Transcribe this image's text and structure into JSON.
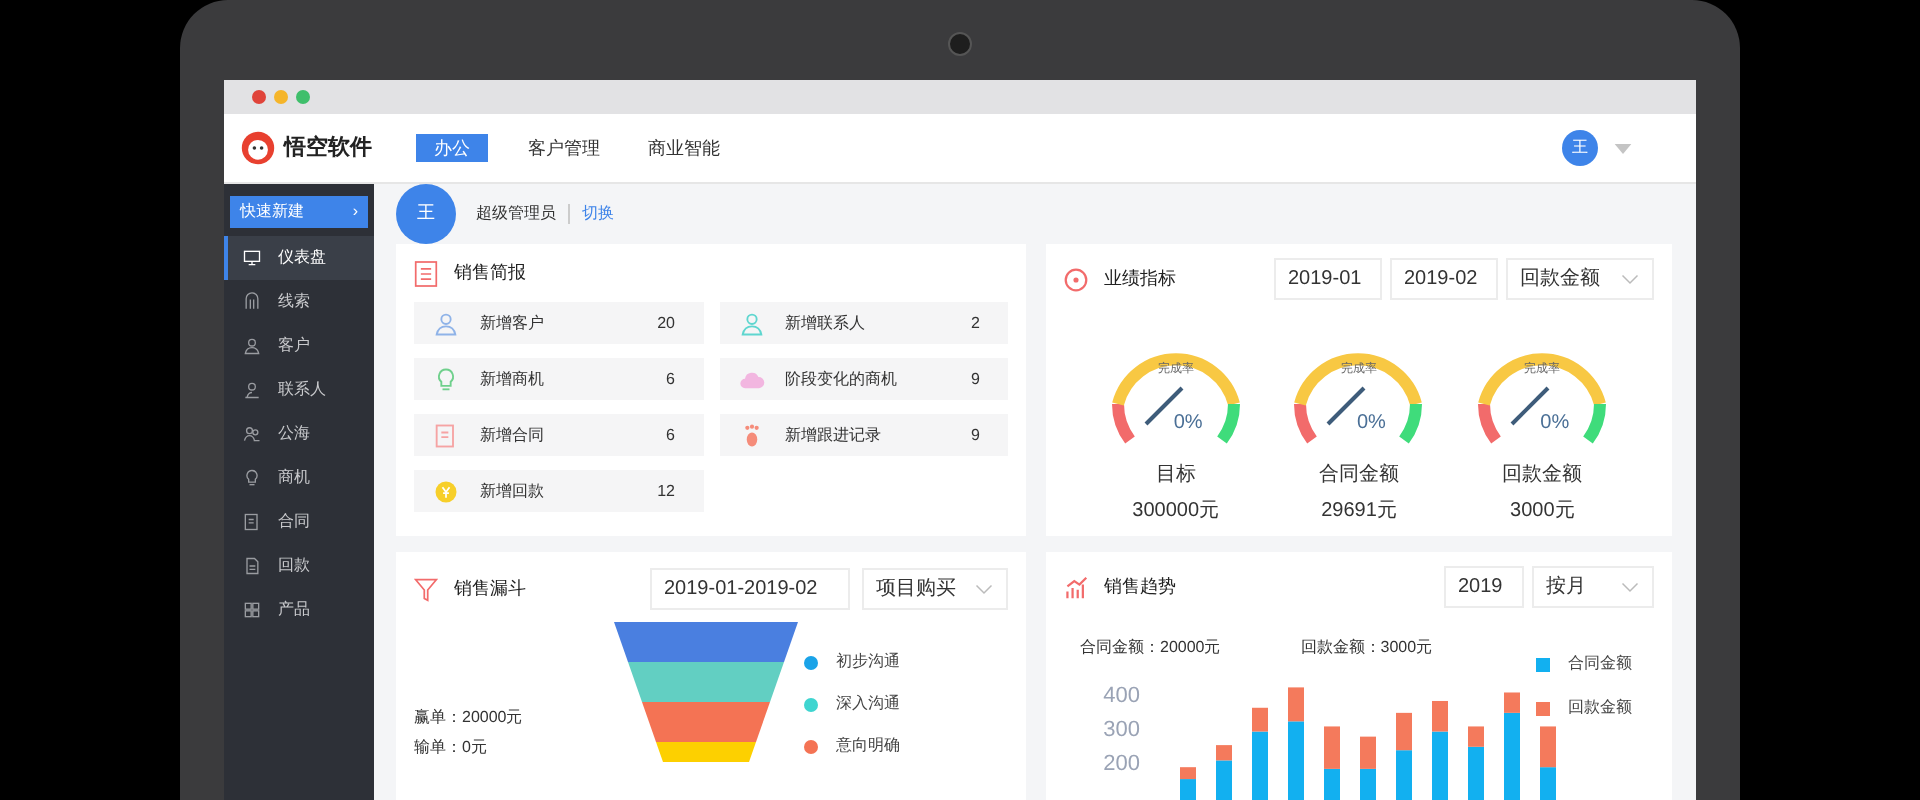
{
  "app": {
    "logo_text": "悟空软件"
  },
  "nav_tabs": [
    {
      "label": "办公",
      "selected": true
    },
    {
      "label": "客户管理",
      "selected": false
    },
    {
      "label": "商业智能",
      "selected": false
    }
  ],
  "header_avatar": "王",
  "sidebar": {
    "quick_create": "快速新建",
    "quick_create_arrow": "›",
    "items": [
      {
        "label": "仪表盘",
        "selected": true
      },
      {
        "label": "线索",
        "selected": false
      },
      {
        "label": "客户",
        "selected": false
      },
      {
        "label": "联系人",
        "selected": false
      },
      {
        "label": "公海",
        "selected": false
      },
      {
        "label": "商机",
        "selected": false
      },
      {
        "label": "合同",
        "selected": false
      },
      {
        "label": "回款",
        "selected": false
      },
      {
        "label": "产品",
        "selected": false
      }
    ]
  },
  "profile": {
    "avatar": "王",
    "role": "超级管理员",
    "switch_link": "切换"
  },
  "sales_brief": {
    "title": "销售简报",
    "items": [
      {
        "label": "新增客户",
        "value": "20",
        "color": "#8fb3e8"
      },
      {
        "label": "新增联系人",
        "value": "2",
        "color": "#5fd6cf"
      },
      {
        "label": "新增商机",
        "value": "6",
        "color": "#6fd08c"
      },
      {
        "label": "阶段变化的商机",
        "value": "9",
        "color": "#f2b6e0"
      },
      {
        "label": "新增合同",
        "value": "6",
        "color": "#f6a3a3"
      },
      {
        "label": "新增跟进记录",
        "value": "9",
        "color": "#f58c7a"
      },
      {
        "label": "新增回款",
        "value": "12",
        "color": "#f7cf2a"
      }
    ]
  },
  "performance": {
    "title": "业绩指标",
    "start": "2019-01",
    "end": "2019-02",
    "select": "回款金额",
    "gauges": [
      {
        "caption": "完成率",
        "percent": "0%",
        "label": "目标",
        "amount": "300000元"
      },
      {
        "caption": "完成率",
        "percent": "0%",
        "label": "合同金额",
        "amount": "29691元"
      },
      {
        "caption": "完成率",
        "percent": "0%",
        "label": "回款金额",
        "amount": "3000元"
      }
    ]
  },
  "funnel": {
    "title": "销售漏斗",
    "range": "2019-01-2019-02",
    "select": "项目购买",
    "won": "赢单：20000元",
    "lost": "输单：0元",
    "stages": [
      {
        "color": "#4a7fe0"
      },
      {
        "color": "#62cfc2"
      },
      {
        "color": "#f47354"
      },
      {
        "color": "#fdd000"
      }
    ],
    "legend": [
      {
        "label": "初步沟通",
        "color": "#1aa3e8"
      },
      {
        "label": "深入沟通",
        "color": "#3fd5d0"
      },
      {
        "label": "意向明确",
        "color": "#f47354"
      }
    ]
  },
  "trend": {
    "title": "销售趋势",
    "year": "2019",
    "select": "按月",
    "contract_total": "合同金额：20000元",
    "payment_total": "回款金额：3000元",
    "chart_data": {
      "type": "bar",
      "stacked": true,
      "categories": [
        null,
        null,
        null,
        null,
        null,
        null,
        null,
        null,
        null,
        null,
        null
      ],
      "ylim": [
        0,
        430
      ],
      "yticks": [
        200,
        300,
        400
      ],
      "series": [
        {
          "name": "合同金额",
          "color": "#12b0f0",
          "values": [
            150,
            205,
            290,
            320,
            180,
            180,
            235,
            290,
            245,
            345,
            185
          ]
        },
        {
          "name": "回款金额",
          "color": "#f47a5c",
          "values": [
            35,
            45,
            70,
            100,
            125,
            95,
            110,
            90,
            60,
            60,
            120
          ]
        }
      ]
    }
  }
}
